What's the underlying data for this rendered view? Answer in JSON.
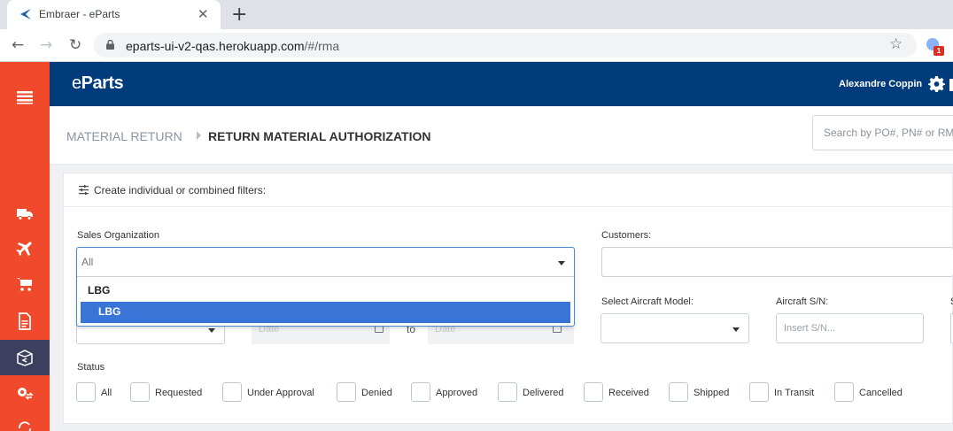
{
  "browser": {
    "tab_title": "Embraer - eParts",
    "close_glyph": "✕",
    "new_tab_glyph": "+",
    "url_host": "eparts-ui-v2-qas.herokuapp.com",
    "url_path": "/#/rma",
    "back_glyph": "←",
    "forward_glyph": "→",
    "reload_glyph": "↻",
    "star_glyph": "☆",
    "extension_badge": "1"
  },
  "sidebar": {
    "items": [
      {
        "icon": "menu-icon"
      },
      {
        "icon": "truck-icon"
      },
      {
        "icon": "airplane-icon"
      },
      {
        "icon": "cart-icon"
      },
      {
        "icon": "document-icon"
      },
      {
        "icon": "return-package-icon",
        "active": true
      },
      {
        "icon": "parts-exchange-icon"
      },
      {
        "icon": "sync-icon"
      }
    ]
  },
  "header": {
    "logo_e": "e",
    "logo_rest": "Parts",
    "user_name": "Alexandre Coppin"
  },
  "breadcrumb": {
    "parent": "MATERIAL RETURN",
    "current": "RETURN MATERIAL AUTHORIZATION"
  },
  "search": {
    "placeholder": "Search by PO#, PN# or RMA#"
  },
  "filters": {
    "title": "Create individual or combined filters:",
    "sales_org_label": "Sales Organization",
    "sales_org_placeholder": "All",
    "sales_org_options": {
      "group": "LBG",
      "highlighted": "LBG"
    },
    "customers_label": "Customers:",
    "aircraft_model_label": "Select Aircraft Model:",
    "aircraft_sn_label": "Aircraft S/N:",
    "aircraft_sn_placeholder": "Insert S/N...",
    "date_from_placeholder": "Date",
    "date_to_label": "to",
    "date_to_placeholder": "Date",
    "status_label": "Status",
    "statuses": [
      "All",
      "Requested",
      "Under Approval",
      "Denied",
      "Approved",
      "Delivered",
      "Received",
      "Shipped",
      "In Transit",
      "Cancelled"
    ]
  },
  "colors": {
    "sidebar": "#f0492b",
    "sidebar_active": "#3d3f5e",
    "header": "#003c7c",
    "highlight": "#3875d7"
  }
}
